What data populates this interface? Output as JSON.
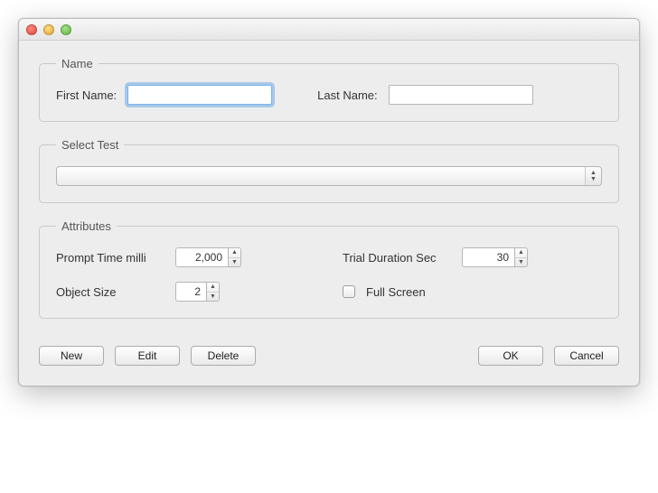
{
  "groups": {
    "name": {
      "legend": "Name",
      "first_label": "First Name:",
      "last_label": "Last Name:",
      "first_value": "",
      "last_value": ""
    },
    "select_test": {
      "legend": "Select Test",
      "selected": ""
    },
    "attributes": {
      "legend": "Attributes",
      "prompt_time": {
        "label": "Prompt Time milli",
        "value": "2,000"
      },
      "trial_duration": {
        "label": "Trial Duration Sec",
        "value": "30"
      },
      "object_size": {
        "label": "Object Size",
        "value": "2"
      },
      "full_screen": {
        "label": "Full Screen",
        "checked": false
      }
    }
  },
  "buttons": {
    "new": "New",
    "edit": "Edit",
    "delete": "Delete",
    "ok": "OK",
    "cancel": "Cancel"
  }
}
